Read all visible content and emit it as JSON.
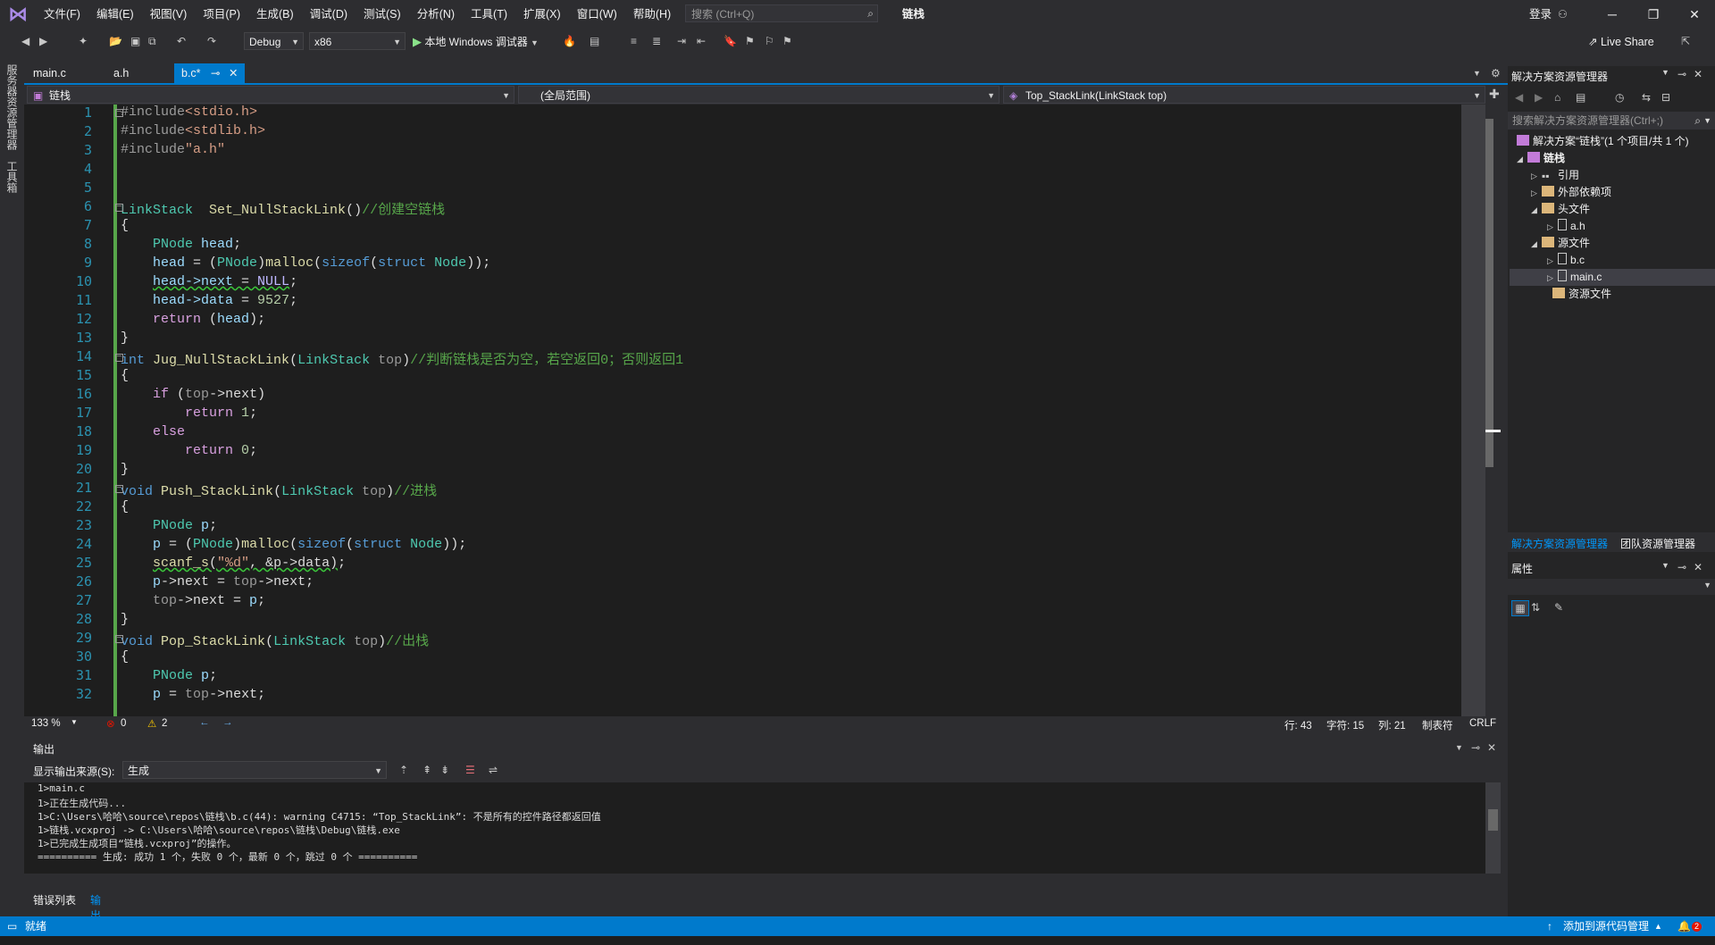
{
  "menubar": {
    "items": [
      "文件(F)",
      "编辑(E)",
      "视图(V)",
      "项目(P)",
      "生成(B)",
      "调试(D)",
      "测试(S)",
      "分析(N)",
      "工具(T)",
      "扩展(X)",
      "窗口(W)",
      "帮助(H)"
    ],
    "search_placeholder": "搜索 (Ctrl+Q)",
    "solution_name": "链栈",
    "login": "登录"
  },
  "toolbar": {
    "config": "Debug",
    "platform": "x86",
    "run_label": "本地 Windows 调试器",
    "live_share": "Live Share"
  },
  "left_tabs": [
    "服务器资源管理器",
    "工具箱"
  ],
  "tabs": [
    {
      "label": "main.c",
      "active": false
    },
    {
      "label": "a.h",
      "active": false
    },
    {
      "label": "b.c*",
      "active": true
    }
  ],
  "navbar": {
    "project": "链栈",
    "scope": "(全局范围)",
    "member": "Top_StackLink(LinkStack top)"
  },
  "line_numbers": [
    "1",
    "2",
    "3",
    "4",
    "5",
    "6",
    "7",
    "8",
    "9",
    "10",
    "11",
    "12",
    "13",
    "14",
    "15",
    "16",
    "17",
    "18",
    "19",
    "20",
    "21",
    "22",
    "23",
    "24",
    "25",
    "26",
    "27",
    "28",
    "29",
    "30",
    "31",
    "32"
  ],
  "code": {
    "l1_pp": "#include",
    "l1_h": "<stdio.h>",
    "l2_pp": "#include",
    "l2_h": "<stdlib.h>",
    "l3_pp": "#include",
    "l3_h": "\"a.h\"",
    "l6_t": "LinkStack",
    "l6_f": "Set_NullStackLink",
    "l6_p": "()",
    "l6_c": "//创建空链栈",
    "brace_open": "{",
    "brace_close": "}",
    "l8_t": "PNode",
    "l8_v": "head",
    "l8_e": ";",
    "l9_v": "head",
    "l9_a": " = (",
    "l9_t": "PNode",
    ")": ")",
    "l9_f": "malloc",
    "l9_b": "(",
    "l9_k": "sizeof",
    "l9_b2": "(",
    "l9_k2": "struct",
    "l9_t2": "Node",
    "l9_e": "));",
    "l10_a": "head->next",
    "l10_b": " = ",
    "l10_m": "NULL",
    "l10_e": ";",
    "l11_a": "head->data",
    "l11_b": " = ",
    "l11_n": "9527",
    "l11_e": ";",
    "l12_k": "return",
    "l12_b": " (",
    "l12_v": "head",
    "l12_e": ");",
    "l14_k": "int",
    "l14_f": "Jug_NullStackLink",
    "l14_p1": "(",
    "l14_t": "LinkStack",
    "l14_v": "top",
    "l14_p2": ")",
    "l14_c": "//判断链栈是否为空，若空返回0；否则返回1",
    "l16_k": "if",
    "l16_b": " (",
    "l16_v": "top",
    "l16_r": "->next)",
    "l17_k": "return",
    "l17_n": "1",
    "l17_e": ";",
    "l18_k": "else",
    "l19_k": "return",
    "l19_n": "0",
    "l19_e": ";",
    "l21_k": "void",
    "l21_f": "Push_StackLink",
    "l21_p1": "(",
    "l21_t": "LinkStack",
    "l21_v": "top",
    "l21_p2": ")",
    "l21_c": "//进栈",
    "l23_t": "PNode",
    "l23_v": "p",
    "l23_e": ";",
    "l24_v": "p",
    "l24_a": " = (",
    "l24_t": "PNode",
    "l24_f": "malloc",
    "l24_k": "sizeof",
    "l24_k2": "struct",
    "l24_t2": "Node",
    "l24_e": "));",
    "l25_f": "scanf_s",
    "l25_b": "(",
    "l25_s": "\"%d\"",
    "l25_r": ", &p->data)",
    "l25_e": ";",
    "l26_v": "p",
    "l26_a": "->next = ",
    "l26_v2": "top",
    "l26_r": "->next;",
    "l27_v": "top",
    "l27_a": "->next = ",
    "l27_v2": "p",
    "l27_e": ";",
    "l29_k": "void",
    "l29_f": "Pop_StackLink",
    "l29_p1": "(",
    "l29_t": "LinkStack",
    "l29_v": "top",
    "l29_p2": ")",
    "l29_c": "//出栈",
    "l31_t": "PNode",
    "l31_v": "p",
    "l31_e": ";",
    "l32_v": "p",
    "l32_a": " = ",
    "l32_v2": "top",
    "l32_r": "->next;"
  },
  "editor_status": {
    "zoom": "133 %",
    "errors": "0",
    "warnings": "2",
    "line": "行: 43",
    "char": "字符: 15",
    "col": "列: 21",
    "tabs": "制表符",
    "eol": "CRLF"
  },
  "output": {
    "title": "输出",
    "source_label": "显示输出来源(S):",
    "source_value": "生成",
    "lines": [
      "1>main.c",
      "1>正在生成代码...",
      "1>C:\\Users\\哈哈\\source\\repos\\链栈\\b.c(44): warning C4715: “Top_StackLink”: 不是所有的控件路径都返回值",
      "1>链栈.vcxproj -> C:\\Users\\哈哈\\source\\repos\\链栈\\Debug\\链栈.exe",
      "1>已完成生成项目“链栈.vcxproj”的操作。",
      "========== 生成: 成功 1 个，失败 0 个，最新 0 个，跳过 0 个 =========="
    ]
  },
  "bottom_tabs": [
    "错误列表",
    "输出"
  ],
  "solution_explorer": {
    "title": "解决方案资源管理器",
    "search_placeholder": "搜索解决方案资源管理器(Ctrl+;)",
    "items": [
      {
        "label": "解决方案“链栈”(1 个项目/共 1 个)"
      },
      {
        "label": "链栈"
      },
      {
        "label": "引用"
      },
      {
        "label": "外部依赖项"
      },
      {
        "label": "头文件"
      },
      {
        "label": "a.h"
      },
      {
        "label": "源文件"
      },
      {
        "label": "b.c"
      },
      {
        "label": "main.c"
      },
      {
        "label": "资源文件"
      }
    ],
    "tab1": "解决方案资源管理器",
    "tab2": "团队资源管理器"
  },
  "properties": {
    "title": "属性"
  },
  "statusbar": {
    "ready": "就绪",
    "source_control": "添加到源代码管理",
    "notifications": "2"
  },
  "colors": {
    "accent": "#007acc",
    "background": "#1e1e1e",
    "chrome": "#2d2d30"
  }
}
